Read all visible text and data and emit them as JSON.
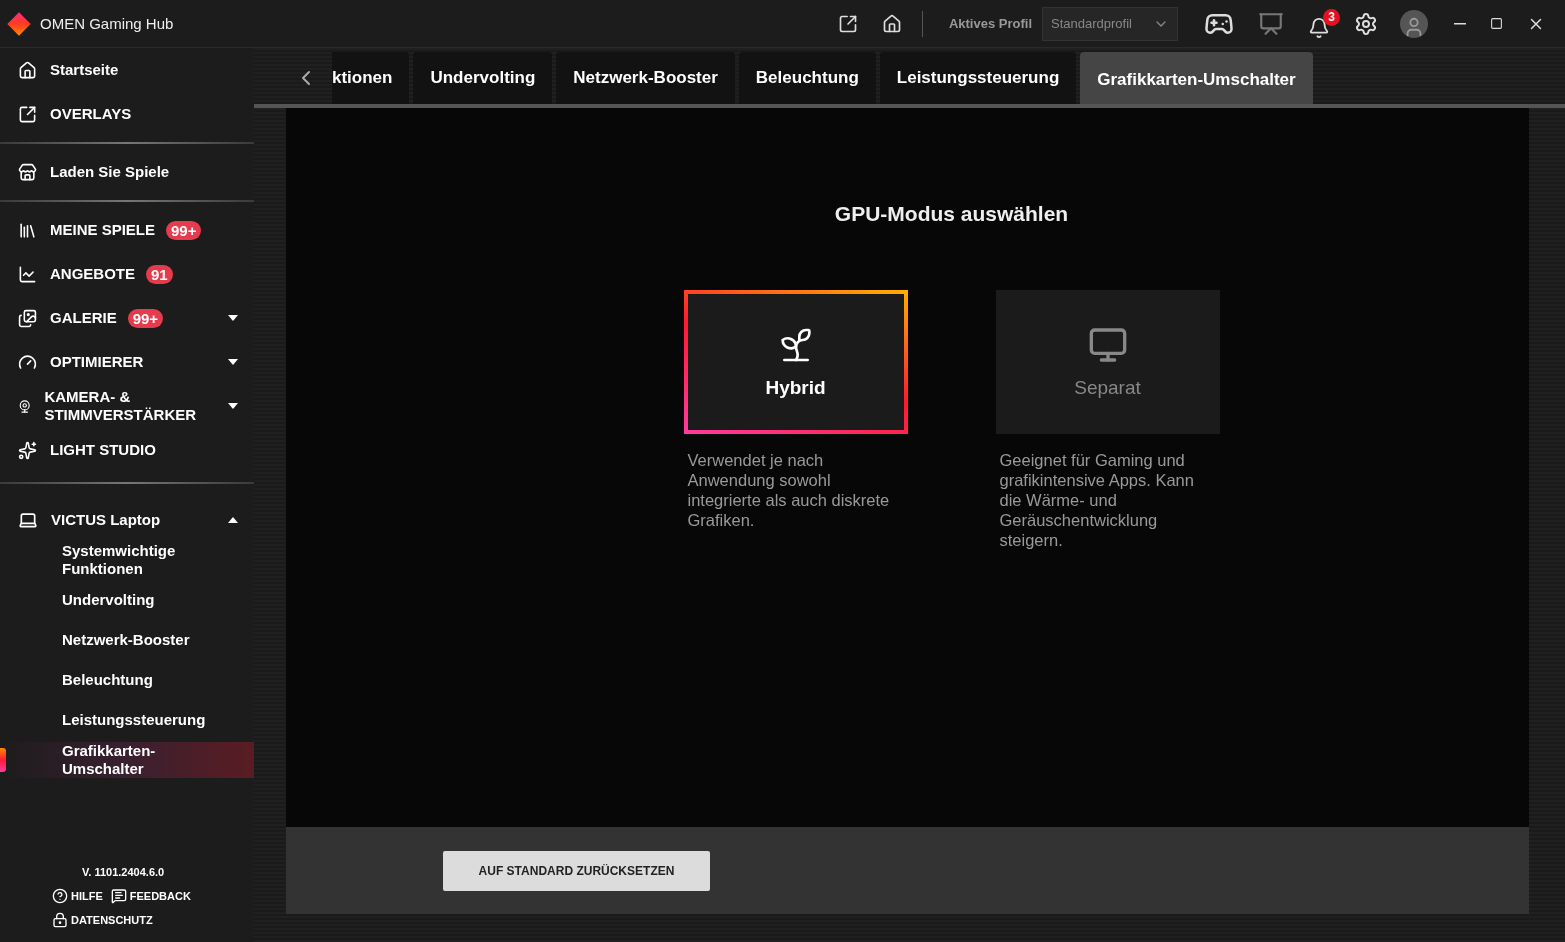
{
  "window": {
    "title": "OMEN Gaming Hub"
  },
  "header": {
    "profile_label": "Aktives Profil",
    "profile_value": "Standardprofil",
    "notification_count": "3"
  },
  "sidebar": {
    "groups": [
      [
        {
          "kind": "home",
          "label": "Startseite"
        },
        {
          "kind": "overlay",
          "label": "OVERLAYS"
        }
      ],
      [
        {
          "kind": "store",
          "label": "Laden Sie Spiele"
        }
      ],
      [
        {
          "kind": "library",
          "label": "MEINE SPIELE",
          "badge": "99+"
        },
        {
          "kind": "chart",
          "label": "ANGEBOTE",
          "badge": "91"
        },
        {
          "kind": "gallery",
          "label": "GALERIE",
          "badge": "99+",
          "expanded": false
        },
        {
          "kind": "gauge",
          "label": "OPTIMIERER",
          "expanded": false
        },
        {
          "kind": "camera",
          "label": "KAMERA- & STIMMVERSTÄRKER",
          "expanded": false
        },
        {
          "kind": "sparkle",
          "label": "LIGHT STUDIO"
        }
      ]
    ],
    "device": {
      "label": "VICTUS Laptop",
      "expanded": true,
      "children": [
        {
          "label": "Systemwichtige Funktionen",
          "selected": false
        },
        {
          "label": "Undervolting",
          "selected": false
        },
        {
          "label": "Netzwerk-Booster",
          "selected": false
        },
        {
          "label": "Beleuchtung",
          "selected": false
        },
        {
          "label": "Leistungssteuerung",
          "selected": false
        },
        {
          "label": "Grafikkarten-Umschalter",
          "selected": true
        }
      ]
    },
    "version": "V. 1101.2404.6.0",
    "links": [
      {
        "kind": "help",
        "label": "HILFE"
      },
      {
        "kind": "feedback",
        "label": "FEEDBACK"
      },
      {
        "kind": "privacy",
        "label": "DATENSCHUTZ"
      }
    ]
  },
  "tabs": [
    {
      "label": "ktionen",
      "selected": false
    },
    {
      "label": "Undervolting",
      "selected": false
    },
    {
      "label": "Netzwerk-Booster",
      "selected": false
    },
    {
      "label": "Beleuchtung",
      "selected": false
    },
    {
      "label": "Leistungssteuerung",
      "selected": false
    },
    {
      "label": "Grafikkarten-Umschalter",
      "selected": true
    }
  ],
  "content": {
    "title": "GPU-Modus auswählen",
    "modes": [
      {
        "kind": "hybrid",
        "label": "Hybrid",
        "selected": true,
        "description": "Verwendet je nach Anwendung sowohl integrierte als auch diskrete Grafiken."
      },
      {
        "kind": "discrete",
        "label": "Separat",
        "selected": false,
        "description": "Geeignet für Gaming und grafikintensive Apps. Kann die Wärme- und Geräuschentwicklung steigern."
      }
    ]
  },
  "reset_button": "AUF STANDARD ZURÜCKSETZEN"
}
